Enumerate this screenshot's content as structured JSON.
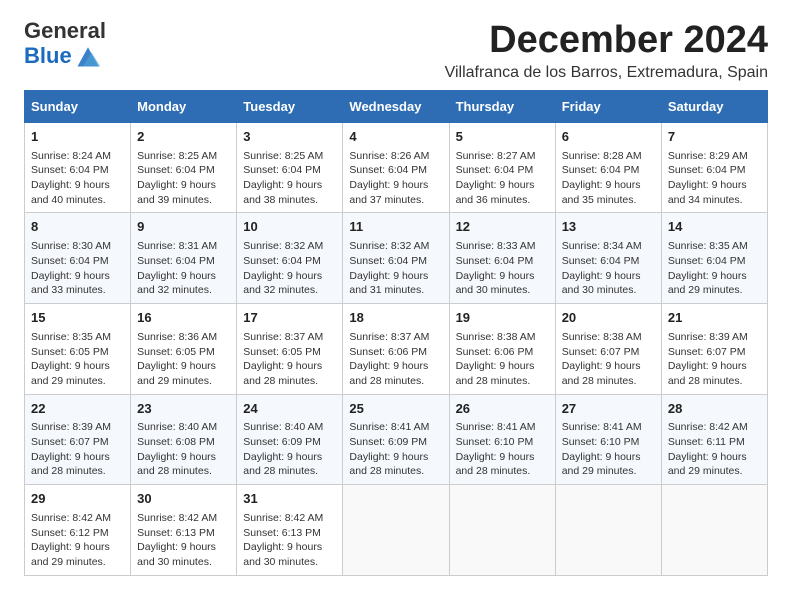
{
  "header": {
    "logo_general": "General",
    "logo_blue": "Blue",
    "month": "December 2024",
    "location": "Villafranca de los Barros, Extremadura, Spain"
  },
  "weekdays": [
    "Sunday",
    "Monday",
    "Tuesday",
    "Wednesday",
    "Thursday",
    "Friday",
    "Saturday"
  ],
  "weeks": [
    [
      {
        "day": "1",
        "info": "Sunrise: 8:24 AM\nSunset: 6:04 PM\nDaylight: 9 hours\nand 40 minutes."
      },
      {
        "day": "2",
        "info": "Sunrise: 8:25 AM\nSunset: 6:04 PM\nDaylight: 9 hours\nand 39 minutes."
      },
      {
        "day": "3",
        "info": "Sunrise: 8:25 AM\nSunset: 6:04 PM\nDaylight: 9 hours\nand 38 minutes."
      },
      {
        "day": "4",
        "info": "Sunrise: 8:26 AM\nSunset: 6:04 PM\nDaylight: 9 hours\nand 37 minutes."
      },
      {
        "day": "5",
        "info": "Sunrise: 8:27 AM\nSunset: 6:04 PM\nDaylight: 9 hours\nand 36 minutes."
      },
      {
        "day": "6",
        "info": "Sunrise: 8:28 AM\nSunset: 6:04 PM\nDaylight: 9 hours\nand 35 minutes."
      },
      {
        "day": "7",
        "info": "Sunrise: 8:29 AM\nSunset: 6:04 PM\nDaylight: 9 hours\nand 34 minutes."
      }
    ],
    [
      {
        "day": "8",
        "info": "Sunrise: 8:30 AM\nSunset: 6:04 PM\nDaylight: 9 hours\nand 33 minutes."
      },
      {
        "day": "9",
        "info": "Sunrise: 8:31 AM\nSunset: 6:04 PM\nDaylight: 9 hours\nand 32 minutes."
      },
      {
        "day": "10",
        "info": "Sunrise: 8:32 AM\nSunset: 6:04 PM\nDaylight: 9 hours\nand 32 minutes."
      },
      {
        "day": "11",
        "info": "Sunrise: 8:32 AM\nSunset: 6:04 PM\nDaylight: 9 hours\nand 31 minutes."
      },
      {
        "day": "12",
        "info": "Sunrise: 8:33 AM\nSunset: 6:04 PM\nDaylight: 9 hours\nand 30 minutes."
      },
      {
        "day": "13",
        "info": "Sunrise: 8:34 AM\nSunset: 6:04 PM\nDaylight: 9 hours\nand 30 minutes."
      },
      {
        "day": "14",
        "info": "Sunrise: 8:35 AM\nSunset: 6:04 PM\nDaylight: 9 hours\nand 29 minutes."
      }
    ],
    [
      {
        "day": "15",
        "info": "Sunrise: 8:35 AM\nSunset: 6:05 PM\nDaylight: 9 hours\nand 29 minutes."
      },
      {
        "day": "16",
        "info": "Sunrise: 8:36 AM\nSunset: 6:05 PM\nDaylight: 9 hours\nand 29 minutes."
      },
      {
        "day": "17",
        "info": "Sunrise: 8:37 AM\nSunset: 6:05 PM\nDaylight: 9 hours\nand 28 minutes."
      },
      {
        "day": "18",
        "info": "Sunrise: 8:37 AM\nSunset: 6:06 PM\nDaylight: 9 hours\nand 28 minutes."
      },
      {
        "day": "19",
        "info": "Sunrise: 8:38 AM\nSunset: 6:06 PM\nDaylight: 9 hours\nand 28 minutes."
      },
      {
        "day": "20",
        "info": "Sunrise: 8:38 AM\nSunset: 6:07 PM\nDaylight: 9 hours\nand 28 minutes."
      },
      {
        "day": "21",
        "info": "Sunrise: 8:39 AM\nSunset: 6:07 PM\nDaylight: 9 hours\nand 28 minutes."
      }
    ],
    [
      {
        "day": "22",
        "info": "Sunrise: 8:39 AM\nSunset: 6:07 PM\nDaylight: 9 hours\nand 28 minutes."
      },
      {
        "day": "23",
        "info": "Sunrise: 8:40 AM\nSunset: 6:08 PM\nDaylight: 9 hours\nand 28 minutes."
      },
      {
        "day": "24",
        "info": "Sunrise: 8:40 AM\nSunset: 6:09 PM\nDaylight: 9 hours\nand 28 minutes."
      },
      {
        "day": "25",
        "info": "Sunrise: 8:41 AM\nSunset: 6:09 PM\nDaylight: 9 hours\nand 28 minutes."
      },
      {
        "day": "26",
        "info": "Sunrise: 8:41 AM\nSunset: 6:10 PM\nDaylight: 9 hours\nand 28 minutes."
      },
      {
        "day": "27",
        "info": "Sunrise: 8:41 AM\nSunset: 6:10 PM\nDaylight: 9 hours\nand 29 minutes."
      },
      {
        "day": "28",
        "info": "Sunrise: 8:42 AM\nSunset: 6:11 PM\nDaylight: 9 hours\nand 29 minutes."
      }
    ],
    [
      {
        "day": "29",
        "info": "Sunrise: 8:42 AM\nSunset: 6:12 PM\nDaylight: 9 hours\nand 29 minutes."
      },
      {
        "day": "30",
        "info": "Sunrise: 8:42 AM\nSunset: 6:13 PM\nDaylight: 9 hours\nand 30 minutes."
      },
      {
        "day": "31",
        "info": "Sunrise: 8:42 AM\nSunset: 6:13 PM\nDaylight: 9 hours\nand 30 minutes."
      },
      {
        "day": "",
        "info": ""
      },
      {
        "day": "",
        "info": ""
      },
      {
        "day": "",
        "info": ""
      },
      {
        "day": "",
        "info": ""
      }
    ]
  ]
}
